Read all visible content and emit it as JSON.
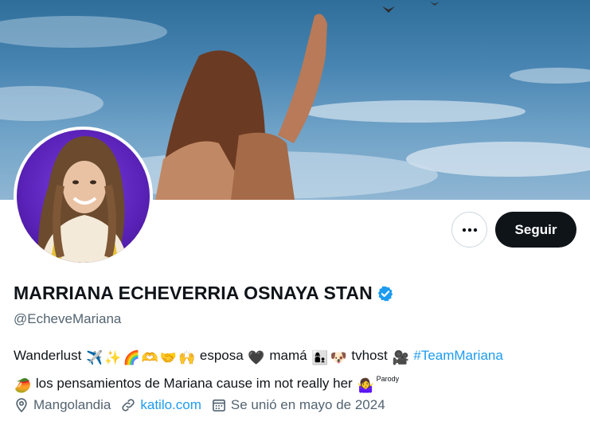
{
  "profile": {
    "display_name": "MARRIANA ECHEVERRIA OSNAYA STAN",
    "handle": "@EcheveMariana",
    "verified": true,
    "follow_label": "Seguir",
    "more_label": "..."
  },
  "bio": {
    "part1": "Wanderlust",
    "part2": "esposa",
    "part3": "mamá",
    "part4": "tvhost",
    "hashtag": "#TeamMariana",
    "part5": "los pensamientos de Mariana cause im not really her",
    "parody_label": "Parody"
  },
  "meta": {
    "location": "Mangolandia",
    "link": "katilo.com",
    "joined": "Se unió en mayo de 2024"
  },
  "colors": {
    "accent": "#1d9bf0",
    "button_dark": "#0f1419",
    "muted": "#536471"
  }
}
